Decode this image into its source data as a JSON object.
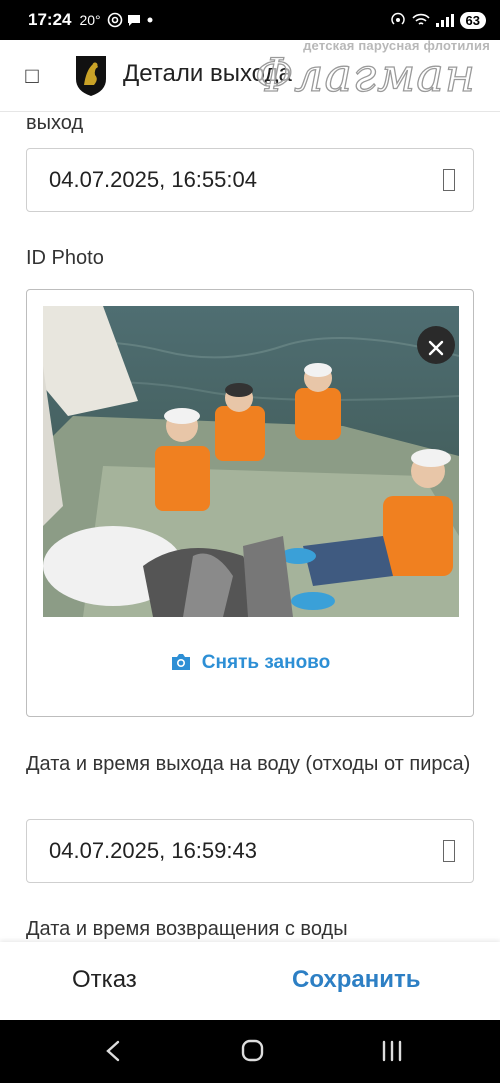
{
  "status_bar": {
    "time": "17:24",
    "temp": "20°",
    "battery": "63",
    "icons": [
      "at-icon",
      "chat-icon",
      "dot-icon",
      "hotspot-icon",
      "wifi-icon",
      "signal-icon",
      "battery-icon"
    ]
  },
  "app_bar": {
    "back_icon": "back-arrow-icon",
    "title": "Детали выхода",
    "watermark_top": "детская парусная флотилия",
    "watermark_main": "Флагман"
  },
  "form": {
    "field1_label_partial": "выход",
    "field1_value": "04.07.2025, 16:55:04",
    "photo_label": "ID Photo",
    "retake_label": "Снять заново",
    "field2_label": "Дата и время выхода на воду (отходы от пирса)",
    "field2_value": "04.07.2025, 16:59:43",
    "field3_label": "Дата и время возвращения с воды"
  },
  "actions": {
    "cancel": "Отказ",
    "save": "Сохранить"
  },
  "colors": {
    "accent": "#2d7fc4",
    "retake": "#2d8fd5"
  }
}
